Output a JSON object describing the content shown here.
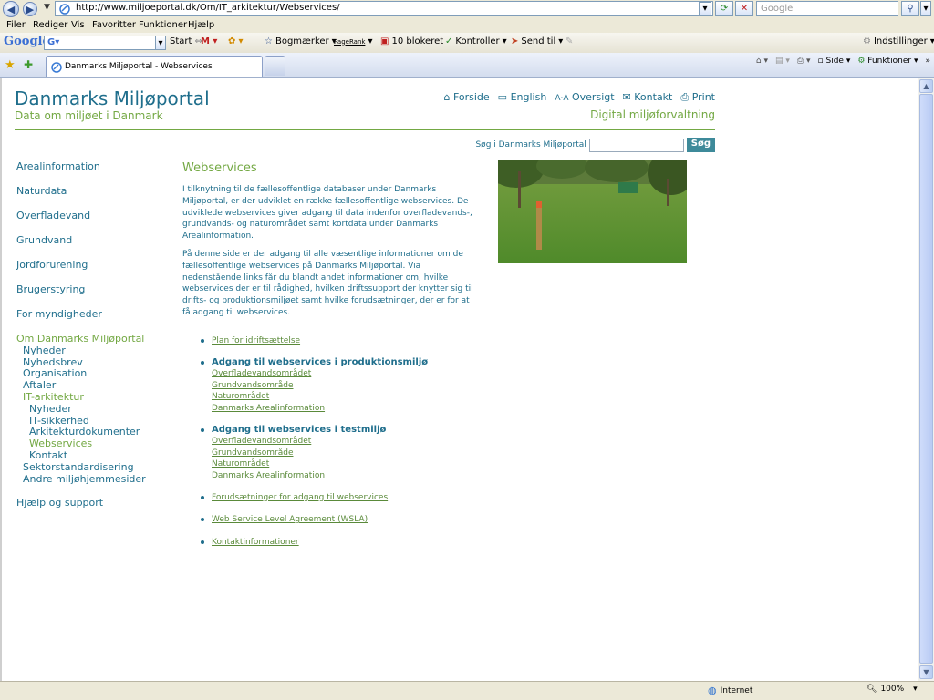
{
  "browser": {
    "url": "http://www.miljoeportal.dk/Om/IT_arkitektur/Webservices/",
    "search_placeholder": "Google",
    "menu": [
      "Filer",
      "Rediger",
      "Vis",
      "Favoritter",
      "Funktioner",
      "Hjælp"
    ],
    "google_label": "Google",
    "toolbar": {
      "start": "Start",
      "bookmarks": "Bogmærker",
      "pagerank": "PageRank",
      "blocked": "10 blokeret",
      "check": "Kontroller",
      "send": "Send til",
      "settings": "Indstillinger"
    },
    "tab_title": "Danmarks Miljøportal - Webservices",
    "commands": {
      "page": "Side",
      "tools": "Funktioner"
    },
    "status": {
      "zone": "Internet",
      "zoom": "100%"
    }
  },
  "site": {
    "title": "Danmarks Miljøportal",
    "subtitle": "Data om miljøet i Danmark",
    "tagline": "Digital miljøforvaltning",
    "toplinks": [
      "Forside",
      "English",
      "Oversigt",
      "Kontakt",
      "Print"
    ],
    "search_label": "Søg i Danmarks Miljøportal",
    "search_button": "Søg"
  },
  "nav": {
    "main": [
      "Arealinformation",
      "Naturdata",
      "Overfladevand",
      "Grundvand",
      "Jordforurening",
      "Brugerstyring",
      "For myndigheder"
    ],
    "about": "Om Danmarks Miljøportal",
    "about_items": [
      "Nyheder",
      "Nyhedsbrev",
      "Organisation",
      "Aftaler"
    ],
    "it": "IT-arkitektur",
    "it_items": [
      "Nyheder",
      "IT-sikkerhed",
      "Arkitekturdokumenter",
      "Webservices",
      "Kontakt"
    ],
    "after_items": [
      "Sektorstandardisering",
      "Andre miljøhjemmesider"
    ],
    "help": "Hjælp og support"
  },
  "content": {
    "heading": "Webservices",
    "p1": "I tilknytning til de fællesoffentlige databaser under Danmarks Miljøportal, er der udviklet en række fællesoffentlige webservices. De udviklede webservices giver adgang til data indenfor overfladevands-, grundvands- og naturområdet samt kortdata under Danmarks Arealinformation.",
    "p2": "På denne side er der adgang til alle væsentlige informationer om de fællesoffentlige webservices på Danmarks Miljøportal. Via nedenstående links får du blandt andet informationer om, hvilke webservices der er til rådighed, hvilken driftssupport der knytter sig til drifts- og produktionsmiljøet samt hvilke forudsætninger, der er for at få adgang til webservices.",
    "link_plan": "Plan for idriftsættelse",
    "prod_header": "Adgang til webservices i produktionsmiljø",
    "prod_links": [
      "Overfladevandsområdet",
      "Grundvandsområde",
      "Naturområdet",
      "Danmarks Arealinformation"
    ],
    "test_header": "Adgang til webservices i testmiljø",
    "test_links": [
      "Overfladevandsområdet",
      "Grundvandsområde",
      "Naturområdet",
      "Danmarks Arealinformation"
    ],
    "link_prereq": "Forudsætninger for adgang til webservices",
    "link_wsla": "Web Service Level Agreement (WSLA)",
    "link_contact": "Kontaktinformationer"
  },
  "colors": {
    "brand_blue": "#1f6e8c",
    "brand_green": "#73a843"
  }
}
